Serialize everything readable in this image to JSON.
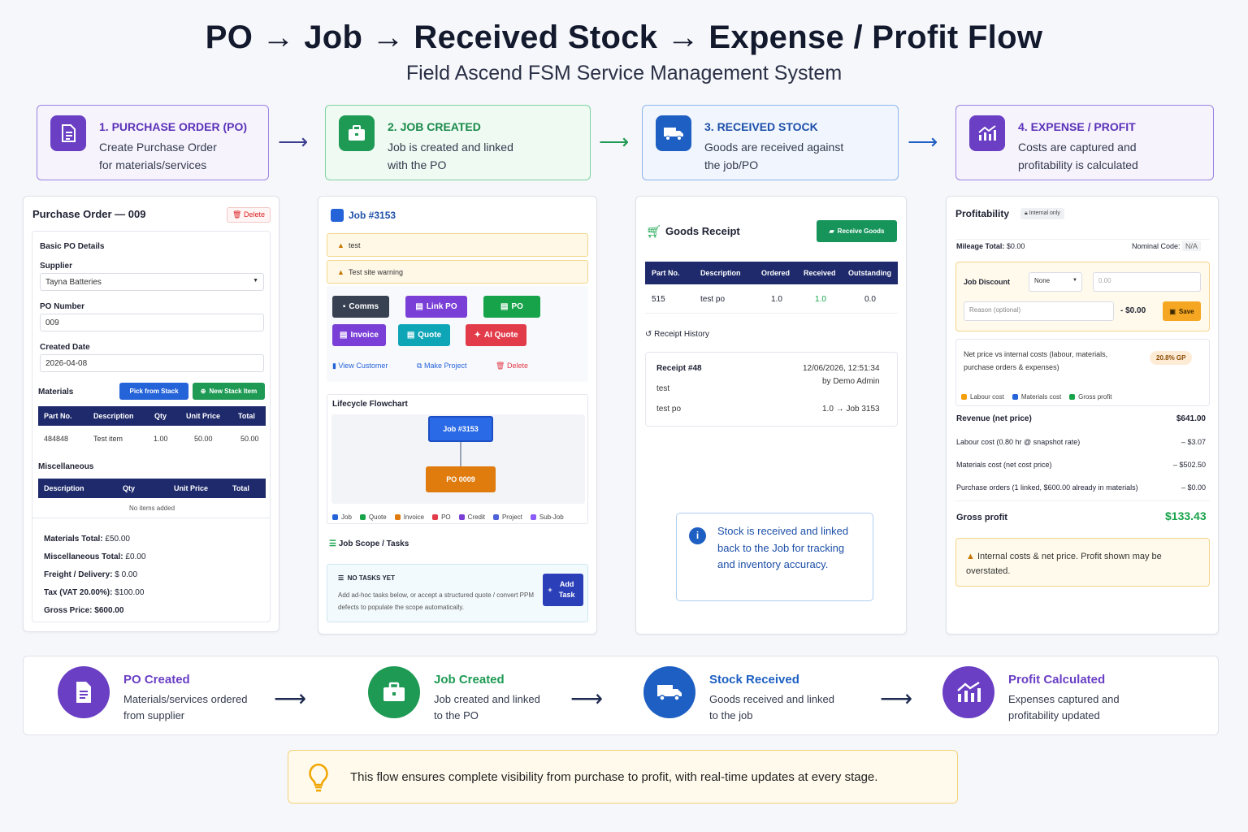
{
  "header": {
    "title": "PO → Job → Received Stock → Expense / Profit Flow",
    "subtitle": "Field Ascend FSM Service Management System"
  },
  "steps": [
    {
      "title": "1. PURCHASE ORDER (PO)",
      "desc": "Create Purchase Order\nfor materials/services",
      "color": "#6a3fc4",
      "bg": "#f3effc",
      "icon": "document-icon"
    },
    {
      "title": "2. JOB CREATED",
      "desc": "Job is created and linked\nwith the PO",
      "color": "#1e9a54",
      "bg": "#ecf8f0",
      "icon": "briefcase-icon"
    },
    {
      "title": "3. RECEIVED STOCK",
      "desc": "Goods are received against\nthe job/PO",
      "color": "#1d5fc2",
      "bg": "#eef4fd",
      "icon": "truck-icon"
    },
    {
      "title": "4. EXPENSE / PROFIT",
      "desc": "Costs are captured and\nprofitability is calculated",
      "color": "#6a3fc4",
      "bg": "#f3effc",
      "icon": "chart-icon"
    }
  ],
  "po": {
    "title": "Purchase Order — 009",
    "delete": "Delete",
    "section": "Basic PO Details",
    "supplier_label": "Supplier",
    "supplier": "Tayna Batteries",
    "po_number_label": "PO Number",
    "po_number": "009",
    "date_label": "Created Date",
    "date": "2026-04-08",
    "materials_label": "Materials",
    "pick_stack": "Pick from Stack",
    "new_stack": "New Stack Item",
    "mat_cols": [
      "Part No.",
      "Description",
      "Qty",
      "Unit Price",
      "Total"
    ],
    "mat_row": [
      "484848",
      "Test item",
      "1.00",
      "50.00",
      "50.00"
    ],
    "misc_label": "Miscellaneous",
    "misc_cols": [
      "Description",
      "Qty",
      "Unit Price",
      "Total"
    ],
    "misc_empty": "No items added",
    "totals": [
      {
        "label": "Materials Total:",
        "value": "£50.00"
      },
      {
        "label": "Miscellaneous Total:",
        "value": "£0.00"
      },
      {
        "label": "Freight / Delivery:",
        "value": "$  0.00"
      },
      {
        "label": "Tax (VAT 20.00%):",
        "value": "$100.00"
      },
      {
        "label": "Gross Price:",
        "value": "$600.00"
      }
    ]
  },
  "job": {
    "title": "Job #3153",
    "warn1": "test",
    "warn2": "Test site warning",
    "buttons": [
      "Comms",
      "Link PO",
      "PO",
      "Invoice",
      "Quote",
      "AI Quote"
    ],
    "links": [
      "View Customer",
      "Make Project",
      "Delete"
    ],
    "flow_title": "Lifecycle Flowchart",
    "node_job": "Job #3153",
    "node_po": "PO 0009",
    "legend": [
      "Job",
      "Quote",
      "Invoice",
      "PO",
      "Credit",
      "Project",
      "Sub-Job"
    ],
    "scope_title": "Job Scope / Tasks",
    "no_tasks": "NO TASKS YET",
    "no_tasks_desc": "Add ad-hoc tasks below, or accept a structured quote / convert PPM defects to populate the scope automatically.",
    "add_task": "Add Task"
  },
  "goods": {
    "title": "Goods Receipt",
    "receive": "Receive Goods",
    "cols": [
      "Part No.",
      "Description",
      "Ordered",
      "Received",
      "Outstanding"
    ],
    "row": [
      "515",
      "test po",
      "1.0",
      "1.0",
      "0.0"
    ],
    "history": "Receipt History",
    "receipt": "Receipt #48",
    "receipt_date": "12/06/2026, 12:51:34",
    "receipt_by": "by Demo Admin",
    "line1": "test",
    "line2": "test po",
    "line2_val": "1.0 → Job 3153",
    "info": "Stock is received and linked back to the Job for tracking and inventory accuracy."
  },
  "profit": {
    "title": "Profitability",
    "badge": "Internal only",
    "mileage_label": "Mileage Total:",
    "mileage": "$0.00",
    "nominal_label": "Nominal Code:",
    "nominal": "N/A",
    "discount_label": "Job Discount",
    "discount_sel": "None",
    "discount_val": "0.00",
    "reason_ph": "Reason (optional)",
    "discount_amt": "- $0.00",
    "save": "Save",
    "note": "Net price vs internal costs (labour, materials, purchase orders & expenses)",
    "gp": "20.8% GP",
    "legend": [
      "Labour cost",
      "Materials cost",
      "Gross profit"
    ],
    "rows": [
      {
        "label": "Revenue (net price)",
        "value": "$641.00"
      },
      {
        "label": "Labour cost (0.80 hr @ snapshot rate)",
        "value": "– $3.07"
      },
      {
        "label": "Materials cost (net cost price)",
        "value": "– $502.50"
      },
      {
        "label": "Purchase orders (1 linked, $600.00 already in materials)",
        "value": "– $0.00"
      }
    ],
    "gross_label": "Gross profit",
    "gross": "$133.43",
    "warn": "Internal costs & net price. Profit shown may be overstated."
  },
  "bottom": [
    {
      "title": "PO Created",
      "desc": "Materials/services ordered\nfrom supplier",
      "color": "#6a3fc4"
    },
    {
      "title": "Job Created",
      "desc": "Job created and linked\nto the PO",
      "color": "#1e9a54"
    },
    {
      "title": "Stock Received",
      "desc": "Goods received and linked\nto the job",
      "color": "#1d5fc2"
    },
    {
      "title": "Profit Calculated",
      "desc": "Expenses captured and\nprofitability updated",
      "color": "#6a3fc4"
    }
  ],
  "footer": "This flow ensures complete visibility from purchase to profit, with real-time updates at every stage."
}
